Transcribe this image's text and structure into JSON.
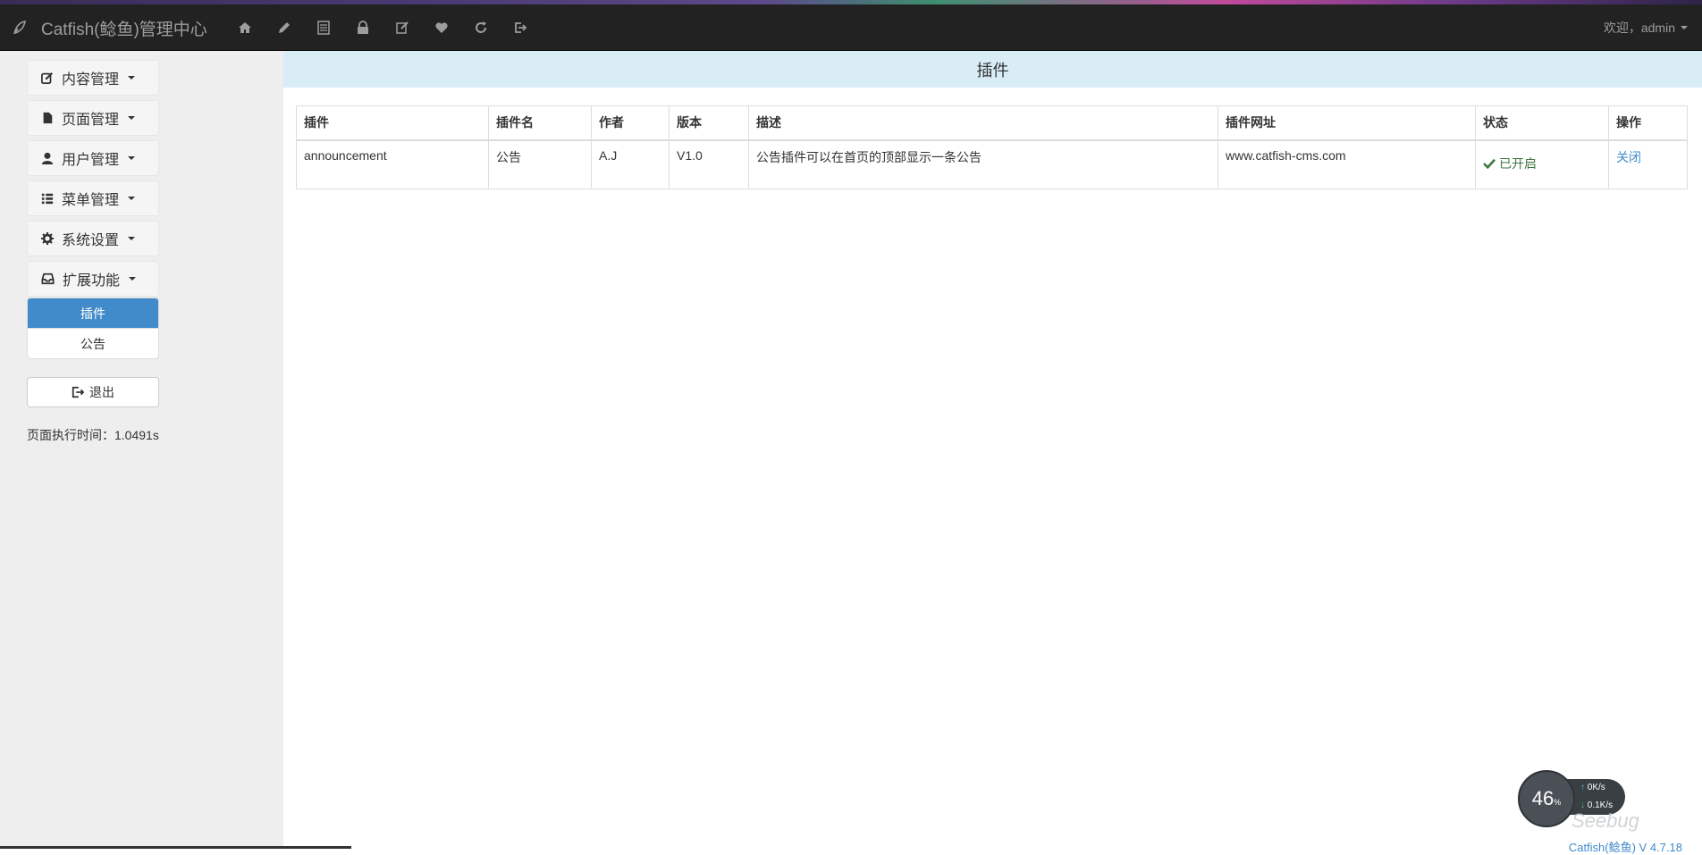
{
  "navbar": {
    "brand": "Catfish(鲶鱼)管理中心",
    "icons": [
      "home-icon",
      "pencil-icon",
      "list-icon",
      "lock-icon",
      "edit-icon",
      "heart-icon",
      "refresh-icon",
      "logout-icon"
    ],
    "welcome": "欢迎，admin"
  },
  "sidebar": {
    "menus": [
      {
        "label": "内容管理",
        "icon": "edit-icon"
      },
      {
        "label": "页面管理",
        "icon": "file-icon"
      },
      {
        "label": "用户管理",
        "icon": "user-icon"
      },
      {
        "label": "菜单管理",
        "icon": "list-icon"
      },
      {
        "label": "系统设置",
        "icon": "gear-icon"
      },
      {
        "label": "扩展功能",
        "icon": "inbox-icon"
      }
    ],
    "submenu": [
      {
        "label": "插件",
        "active": true
      },
      {
        "label": "公告",
        "active": false
      }
    ],
    "logout": "退出",
    "exec_time": "页面执行时间：1.0491s"
  },
  "main": {
    "title": "插件",
    "table": {
      "headers": [
        "插件",
        "插件名",
        "作者",
        "版本",
        "描述",
        "插件网址",
        "状态",
        "操作"
      ],
      "rows": [
        {
          "plugin": "announcement",
          "name": "公告",
          "author": "A.J",
          "version": "V1.0",
          "description": "公告插件可以在首页的顶部显示一条公告",
          "url": "www.catfish-cms.com",
          "status": "已开启",
          "action": "关闭"
        }
      ]
    }
  },
  "footer": {
    "version": "Catfish(鲶鱼) V 4.7.18"
  },
  "widget": {
    "percent": "46",
    "percent_unit": "%",
    "up": "0K/s",
    "down": "0.1K/s"
  },
  "watermark": "Seebug",
  "colors": {
    "navbar_bg": "#222222",
    "sidebar_bg": "#eeeeee",
    "primary": "#428bca",
    "title_bar": "#d9edf7",
    "success": "#3c763d"
  }
}
